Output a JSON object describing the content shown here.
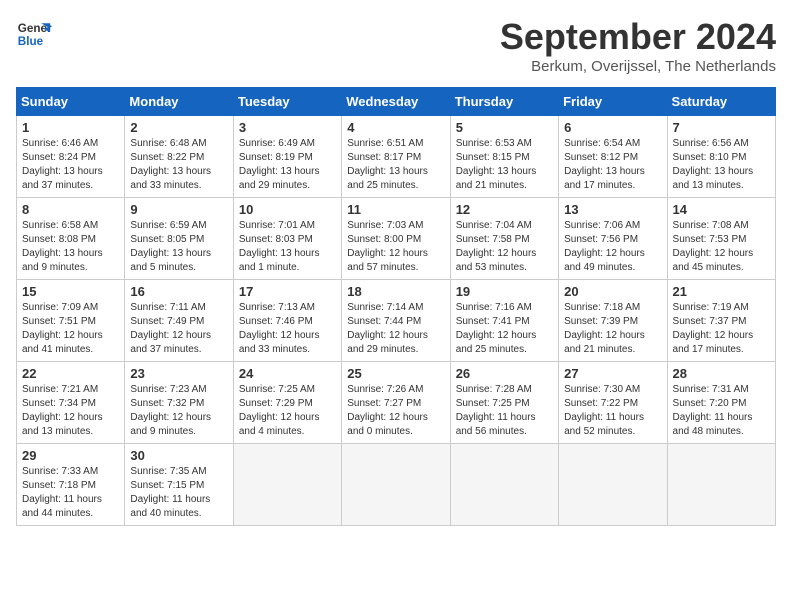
{
  "header": {
    "logo_line1": "General",
    "logo_line2": "Blue",
    "title": "September 2024",
    "subtitle": "Berkum, Overijssel, The Netherlands"
  },
  "weekdays": [
    "Sunday",
    "Monday",
    "Tuesday",
    "Wednesday",
    "Thursday",
    "Friday",
    "Saturday"
  ],
  "weeks": [
    [
      {
        "day": "1",
        "info": "Sunrise: 6:46 AM\nSunset: 8:24 PM\nDaylight: 13 hours\nand 37 minutes."
      },
      {
        "day": "2",
        "info": "Sunrise: 6:48 AM\nSunset: 8:22 PM\nDaylight: 13 hours\nand 33 minutes."
      },
      {
        "day": "3",
        "info": "Sunrise: 6:49 AM\nSunset: 8:19 PM\nDaylight: 13 hours\nand 29 minutes."
      },
      {
        "day": "4",
        "info": "Sunrise: 6:51 AM\nSunset: 8:17 PM\nDaylight: 13 hours\nand 25 minutes."
      },
      {
        "day": "5",
        "info": "Sunrise: 6:53 AM\nSunset: 8:15 PM\nDaylight: 13 hours\nand 21 minutes."
      },
      {
        "day": "6",
        "info": "Sunrise: 6:54 AM\nSunset: 8:12 PM\nDaylight: 13 hours\nand 17 minutes."
      },
      {
        "day": "7",
        "info": "Sunrise: 6:56 AM\nSunset: 8:10 PM\nDaylight: 13 hours\nand 13 minutes."
      }
    ],
    [
      {
        "day": "8",
        "info": "Sunrise: 6:58 AM\nSunset: 8:08 PM\nDaylight: 13 hours\nand 9 minutes."
      },
      {
        "day": "9",
        "info": "Sunrise: 6:59 AM\nSunset: 8:05 PM\nDaylight: 13 hours\nand 5 minutes."
      },
      {
        "day": "10",
        "info": "Sunrise: 7:01 AM\nSunset: 8:03 PM\nDaylight: 13 hours\nand 1 minute."
      },
      {
        "day": "11",
        "info": "Sunrise: 7:03 AM\nSunset: 8:00 PM\nDaylight: 12 hours\nand 57 minutes."
      },
      {
        "day": "12",
        "info": "Sunrise: 7:04 AM\nSunset: 7:58 PM\nDaylight: 12 hours\nand 53 minutes."
      },
      {
        "day": "13",
        "info": "Sunrise: 7:06 AM\nSunset: 7:56 PM\nDaylight: 12 hours\nand 49 minutes."
      },
      {
        "day": "14",
        "info": "Sunrise: 7:08 AM\nSunset: 7:53 PM\nDaylight: 12 hours\nand 45 minutes."
      }
    ],
    [
      {
        "day": "15",
        "info": "Sunrise: 7:09 AM\nSunset: 7:51 PM\nDaylight: 12 hours\nand 41 minutes."
      },
      {
        "day": "16",
        "info": "Sunrise: 7:11 AM\nSunset: 7:49 PM\nDaylight: 12 hours\nand 37 minutes."
      },
      {
        "day": "17",
        "info": "Sunrise: 7:13 AM\nSunset: 7:46 PM\nDaylight: 12 hours\nand 33 minutes."
      },
      {
        "day": "18",
        "info": "Sunrise: 7:14 AM\nSunset: 7:44 PM\nDaylight: 12 hours\nand 29 minutes."
      },
      {
        "day": "19",
        "info": "Sunrise: 7:16 AM\nSunset: 7:41 PM\nDaylight: 12 hours\nand 25 minutes."
      },
      {
        "day": "20",
        "info": "Sunrise: 7:18 AM\nSunset: 7:39 PM\nDaylight: 12 hours\nand 21 minutes."
      },
      {
        "day": "21",
        "info": "Sunrise: 7:19 AM\nSunset: 7:37 PM\nDaylight: 12 hours\nand 17 minutes."
      }
    ],
    [
      {
        "day": "22",
        "info": "Sunrise: 7:21 AM\nSunset: 7:34 PM\nDaylight: 12 hours\nand 13 minutes."
      },
      {
        "day": "23",
        "info": "Sunrise: 7:23 AM\nSunset: 7:32 PM\nDaylight: 12 hours\nand 9 minutes."
      },
      {
        "day": "24",
        "info": "Sunrise: 7:25 AM\nSunset: 7:29 PM\nDaylight: 12 hours\nand 4 minutes."
      },
      {
        "day": "25",
        "info": "Sunrise: 7:26 AM\nSunset: 7:27 PM\nDaylight: 12 hours\nand 0 minutes."
      },
      {
        "day": "26",
        "info": "Sunrise: 7:28 AM\nSunset: 7:25 PM\nDaylight: 11 hours\nand 56 minutes."
      },
      {
        "day": "27",
        "info": "Sunrise: 7:30 AM\nSunset: 7:22 PM\nDaylight: 11 hours\nand 52 minutes."
      },
      {
        "day": "28",
        "info": "Sunrise: 7:31 AM\nSunset: 7:20 PM\nDaylight: 11 hours\nand 48 minutes."
      }
    ],
    [
      {
        "day": "29",
        "info": "Sunrise: 7:33 AM\nSunset: 7:18 PM\nDaylight: 11 hours\nand 44 minutes."
      },
      {
        "day": "30",
        "info": "Sunrise: 7:35 AM\nSunset: 7:15 PM\nDaylight: 11 hours\nand 40 minutes."
      },
      {
        "day": "",
        "info": ""
      },
      {
        "day": "",
        "info": ""
      },
      {
        "day": "",
        "info": ""
      },
      {
        "day": "",
        "info": ""
      },
      {
        "day": "",
        "info": ""
      }
    ]
  ]
}
